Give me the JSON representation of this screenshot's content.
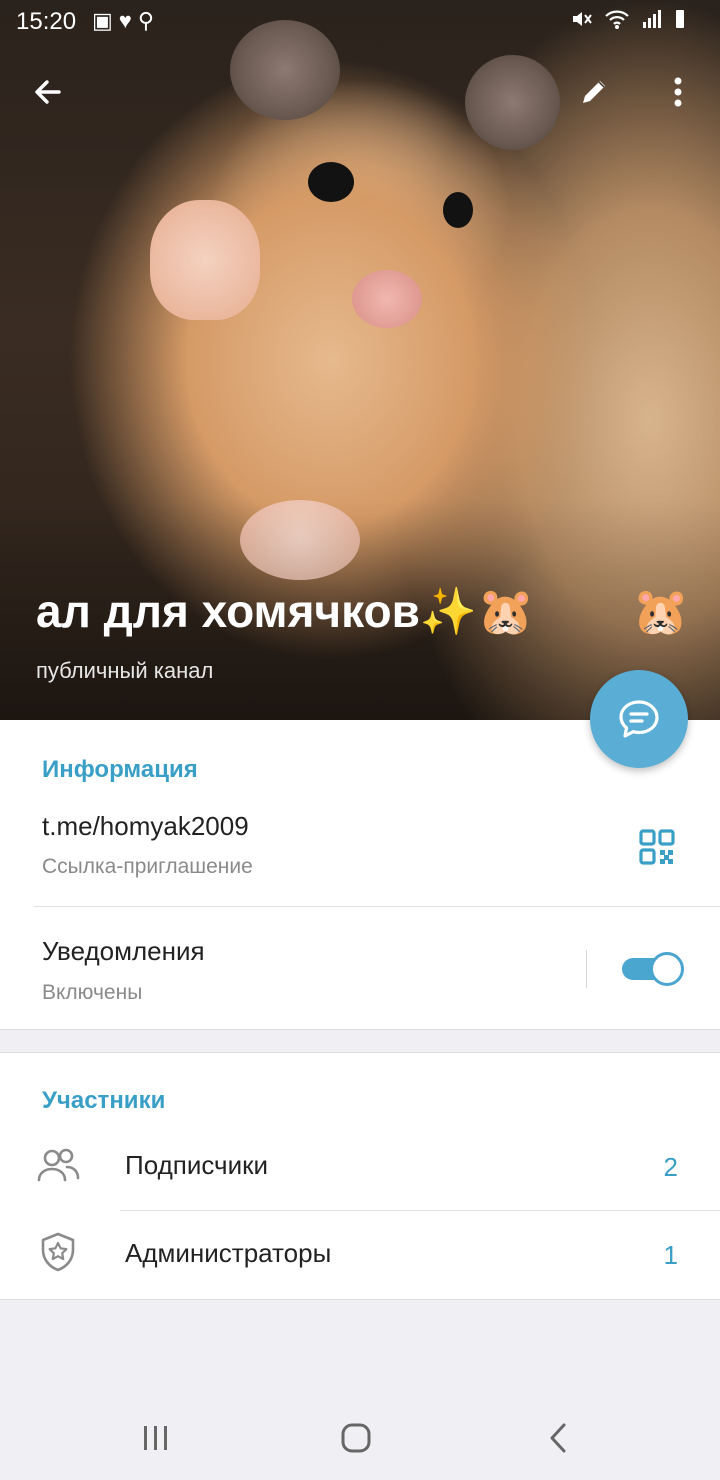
{
  "status_bar": {
    "time": "15:20",
    "left_icons": [
      "image-icon",
      "heart-icon",
      "search-icon"
    ],
    "right_icons": [
      "mute-icon",
      "wifi-icon",
      "signal-icon",
      "battery-icon"
    ]
  },
  "header": {
    "back_icon": "arrow-left-icon",
    "edit_icon": "pencil-icon",
    "more_icon": "more-vertical-icon",
    "title": "ал для хомячков✨🐹",
    "title_trailing_emoji": "🐹",
    "subtitle": "публичный канал"
  },
  "fab": {
    "icon": "chat-bubble-icon"
  },
  "info": {
    "header": "Информация",
    "link": "t.me/homyak2009",
    "link_caption": "Ссылка-приглашение",
    "qr_icon": "qr-code-icon",
    "notifications_label": "Уведомления",
    "notifications_status": "Включены",
    "notifications_enabled": true
  },
  "members": {
    "header": "Участники",
    "items": [
      {
        "label": "Подписчики",
        "count": "2",
        "icon": "users-icon"
      },
      {
        "label": "Администраторы",
        "count": "1",
        "icon": "shield-star-icon"
      }
    ]
  },
  "colors": {
    "accent": "#3a9fc7",
    "fab": "#5aaed6",
    "background": "#efeff4"
  },
  "nav_bar": {
    "icons": [
      "recent-apps-icon",
      "home-icon",
      "back-icon"
    ]
  }
}
